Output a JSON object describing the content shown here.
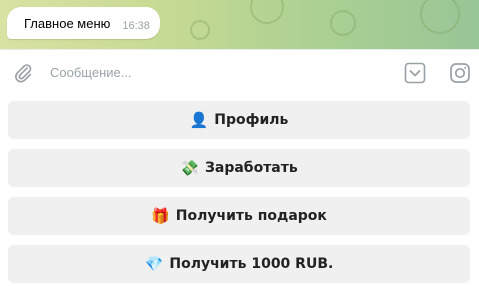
{
  "chat": {
    "message_text": "Главное меню",
    "message_time": "16:38"
  },
  "composer": {
    "placeholder": "Сообщение..."
  },
  "icons": {
    "attach": "paperclip-icon",
    "keyboard": "keyboard-toggle-icon",
    "camera": "instagram-camera-icon"
  },
  "keyboard_buttons": [
    {
      "emoji": "👤",
      "label": "Профиль"
    },
    {
      "emoji": "💸",
      "label": "Заработать"
    },
    {
      "emoji": "🎁",
      "label": "Получить подарок"
    },
    {
      "emoji": "💎",
      "label": "Получить 1000 RUB."
    }
  ],
  "colors": {
    "button_bg": "#f0f0f0",
    "chat_bg_start": "#d8e2a3",
    "chat_bg_end": "#98c596"
  }
}
